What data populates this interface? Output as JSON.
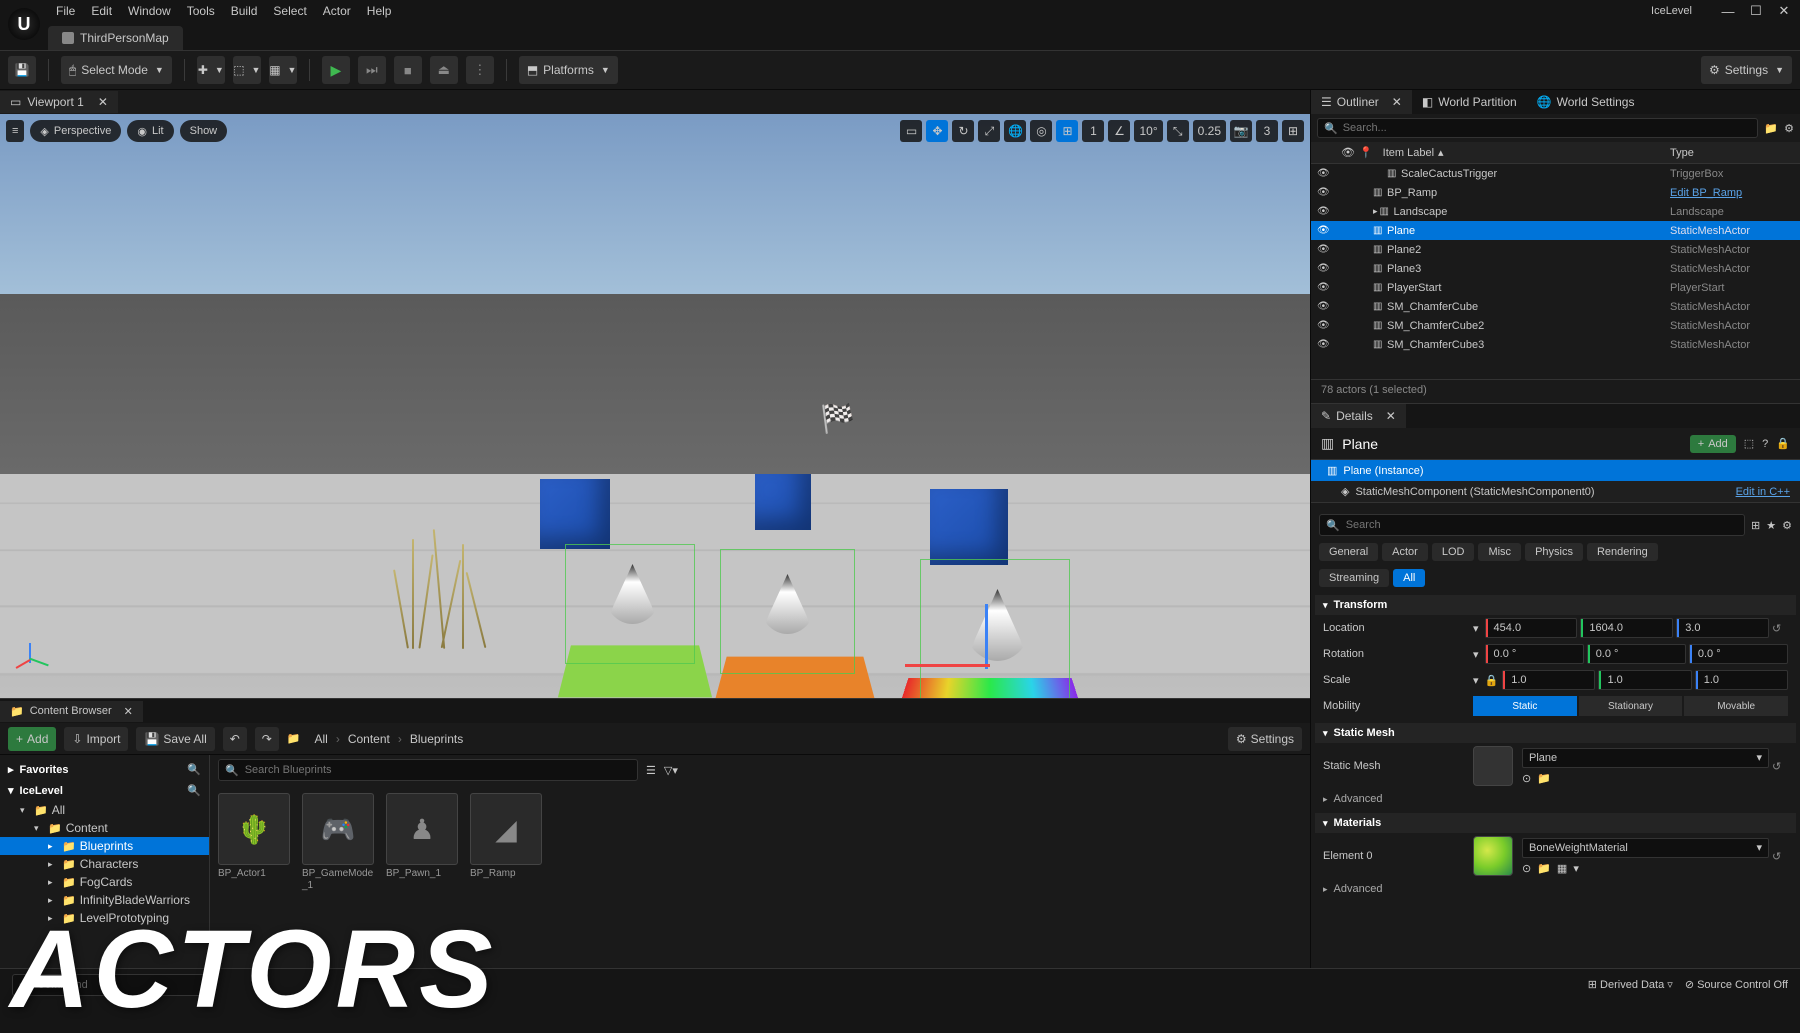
{
  "level_name": "IceLevel",
  "menu": [
    "File",
    "Edit",
    "Window",
    "Tools",
    "Build",
    "Select",
    "Actor",
    "Help"
  ],
  "map_tab": "ThirdPersonMap",
  "toolbar": {
    "select_mode": "Select Mode",
    "platforms": "Platforms",
    "settings": "Settings"
  },
  "viewport": {
    "tab": "Viewport 1",
    "perspective": "Perspective",
    "lit": "Lit",
    "show": "Show",
    "angle": "10°",
    "snap_scale": "0.25",
    "cam_speed": "3",
    "grid_snap": "1"
  },
  "outliner": {
    "title": "Outliner",
    "tabs": {
      "world_partition": "World Partition",
      "world_settings": "World Settings"
    },
    "search_placeholder": "Search...",
    "col_label": "Item Label",
    "col_type": "Type",
    "rows": [
      {
        "label": "ScaleCactusTrigger",
        "type": "TriggerBox",
        "indent": 3
      },
      {
        "label": "BP_Ramp",
        "type": "Edit BP_Ramp",
        "indent": 2,
        "link": true
      },
      {
        "label": "Landscape",
        "type": "Landscape",
        "indent": 2,
        "exp": true
      },
      {
        "label": "Plane",
        "type": "StaticMeshActor",
        "indent": 2,
        "sel": true
      },
      {
        "label": "Plane2",
        "type": "StaticMeshActor",
        "indent": 2
      },
      {
        "label": "Plane3",
        "type": "StaticMeshActor",
        "indent": 2
      },
      {
        "label": "PlayerStart",
        "type": "PlayerStart",
        "indent": 2
      },
      {
        "label": "SM_ChamferCube",
        "type": "StaticMeshActor",
        "indent": 2
      },
      {
        "label": "SM_ChamferCube2",
        "type": "StaticMeshActor",
        "indent": 2
      },
      {
        "label": "SM_ChamferCube3",
        "type": "StaticMeshActor",
        "indent": 2
      }
    ],
    "footer": "78 actors (1 selected)"
  },
  "details": {
    "title": "Details",
    "actor_name": "Plane",
    "add": "Add",
    "instance": "Plane (Instance)",
    "component": "StaticMeshComponent (StaticMeshComponent0)",
    "edit_cpp": "Edit in C++",
    "search_placeholder": "Search",
    "filters": [
      "General",
      "Actor",
      "LOD",
      "Misc",
      "Physics",
      "Rendering"
    ],
    "filters2": [
      "Streaming",
      "All"
    ],
    "transform": {
      "title": "Transform",
      "location_label": "Location",
      "rotation_label": "Rotation",
      "scale_label": "Scale",
      "mobility_label": "Mobility",
      "location": [
        "454.0",
        "1604.0",
        "3.0"
      ],
      "rotation": [
        "0.0 °",
        "0.0 °",
        "0.0 °"
      ],
      "scale": [
        "1.0",
        "1.0",
        "1.0"
      ],
      "mobility": [
        "Static",
        "Stationary",
        "Movable"
      ]
    },
    "static_mesh": {
      "title": "Static Mesh",
      "label": "Static Mesh",
      "value": "Plane"
    },
    "advanced": "Advanced",
    "materials": {
      "title": "Materials",
      "element": "Element 0",
      "value": "BoneWeightMaterial"
    }
  },
  "content_browser": {
    "title": "Content Browser",
    "add": "Add",
    "import": "Import",
    "save_all": "Save All",
    "breadcrumb": [
      "All",
      "Content",
      "Blueprints"
    ],
    "settings": "Settings",
    "favorites": "Favorites",
    "project": "IceLevel",
    "search_placeholder": "Search Blueprints",
    "tree": [
      {
        "label": "All",
        "depth": 0,
        "exp": true
      },
      {
        "label": "Content",
        "depth": 1,
        "exp": true
      },
      {
        "label": "Blueprints",
        "depth": 2,
        "sel": true
      },
      {
        "label": "Characters",
        "depth": 2
      },
      {
        "label": "FogCards",
        "depth": 2
      },
      {
        "label": "InfinityBladeWarriors",
        "depth": 2
      },
      {
        "label": "LevelPrototyping",
        "depth": 2
      }
    ],
    "assets": [
      {
        "name": "BP_Actor1",
        "icon": "🌵"
      },
      {
        "name": "BP_GameMode_1",
        "icon": "🎮"
      },
      {
        "name": "BP_Pawn_1",
        "icon": "♟"
      },
      {
        "name": "BP_Ramp",
        "icon": "◢"
      }
    ]
  },
  "statusbar": {
    "cmd_placeholder": "~le Command",
    "derived": "Derived Data",
    "source_ctrl": "Source Control Off"
  },
  "big_label": "ACTORS"
}
